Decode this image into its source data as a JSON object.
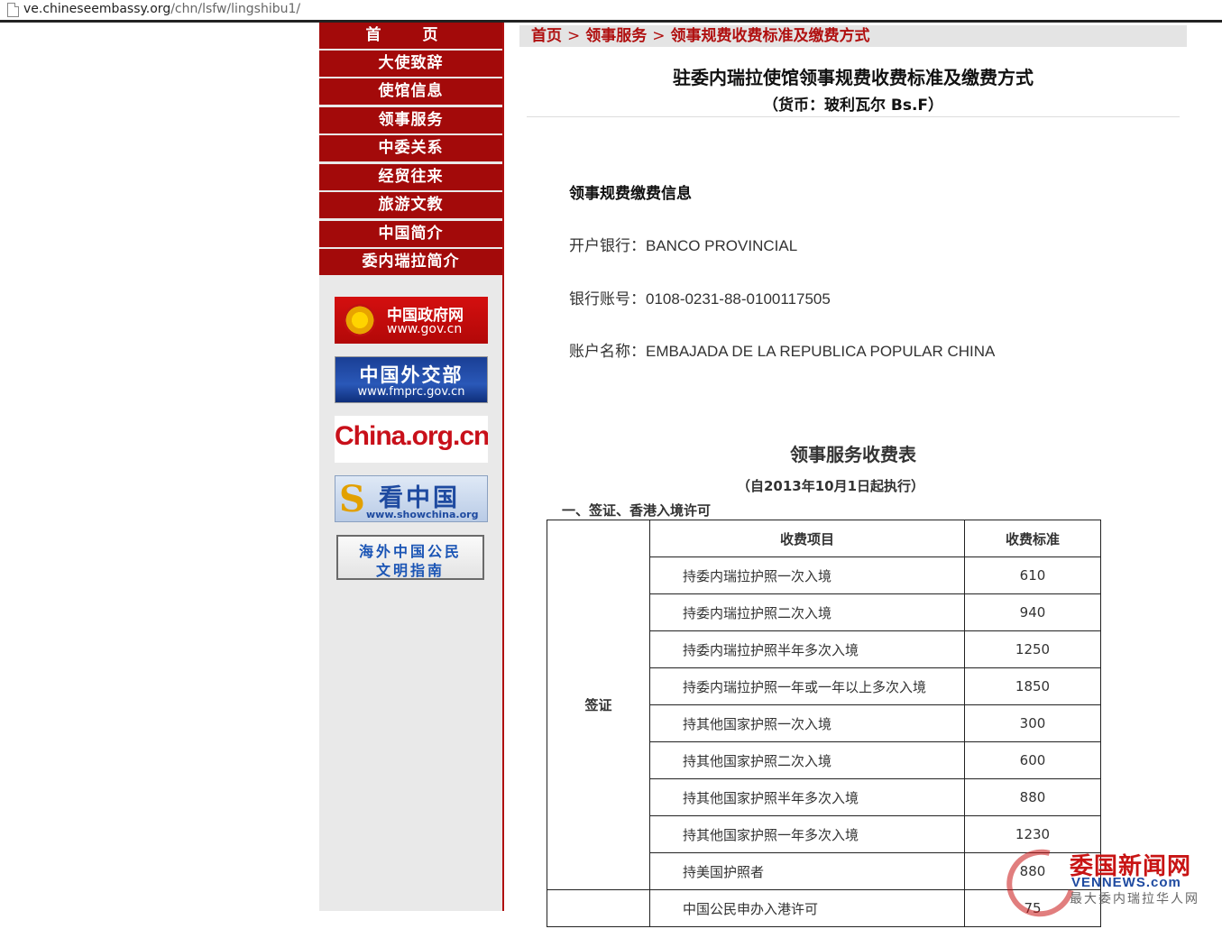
{
  "browser": {
    "url_host": "ve.chineseembassy.org",
    "url_path": "/chn/lsfw/lingshibu1/"
  },
  "nav": {
    "items": [
      "首  页",
      "大使致辞",
      "使馆信息",
      "领事服务",
      "中委关系",
      "经贸往来",
      "旅游文教",
      "中国简介",
      "委内瑞拉简介"
    ]
  },
  "banners": {
    "gov": {
      "line1": "中国政府网",
      "line2": "www.gov.cn"
    },
    "fmprc": {
      "line1": "中国外交部",
      "line2": "www.fmprc.gov.cn"
    },
    "chinaorg": {
      "line1": "China.org.cn"
    },
    "showchina": {
      "line1": "看中国",
      "line2": "www.showchina.org"
    },
    "civ": {
      "line1": "海外中国公民",
      "line2": "文明指南"
    }
  },
  "breadcrumb": {
    "items": [
      "首页",
      "领事服务",
      "领事规费收费标准及缴费方式"
    ],
    "separator": ">"
  },
  "page": {
    "title": "驻委内瑞拉使馆领事规费收费标准及缴费方式",
    "subtitle": "（货币：玻利瓦尔 Bs.F）"
  },
  "payment": {
    "heading": "领事规费缴费信息",
    "bank_label": "开户银行：",
    "bank_value": "BANCO PROVINCIAL",
    "account_label": "银行账号：",
    "account_value": "0108-0231-88-0100117505",
    "name_label": "账户名称：",
    "name_value": "EMBAJADA DE LA REPUBLICA POPULAR CHINA"
  },
  "fees": {
    "title": "领事服务收费表",
    "effective": "（自2013年10月1日起执行）",
    "category_heading": "一、签证、香港入境许可",
    "col_item": "收费项目",
    "col_fee": "收费标准",
    "visa_category": "签证",
    "rows": [
      {
        "item": "持委内瑞拉护照一次入境",
        "fee": "610"
      },
      {
        "item": "持委内瑞拉护照二次入境",
        "fee": "940"
      },
      {
        "item": "持委内瑞拉护照半年多次入境",
        "fee": "1250"
      },
      {
        "item": "持委内瑞拉护照一年或一年以上多次入境",
        "fee": "1850"
      },
      {
        "item": "持其他国家护照一次入境",
        "fee": "300"
      },
      {
        "item": "持其他国家护照二次入境",
        "fee": "600"
      },
      {
        "item": "持其他国家护照半年多次入境",
        "fee": "880"
      },
      {
        "item": "持其他国家护照一年多次入境",
        "fee": "1230"
      },
      {
        "item": "持美国护照者",
        "fee": "880"
      }
    ],
    "partial_row": {
      "item": "中国公民申办入港许可",
      "fee": "75"
    }
  },
  "watermark": {
    "line1": "委国新闻网",
    "line2": "VENNEWS.com",
    "line3": "最大委内瑞拉华人网"
  }
}
